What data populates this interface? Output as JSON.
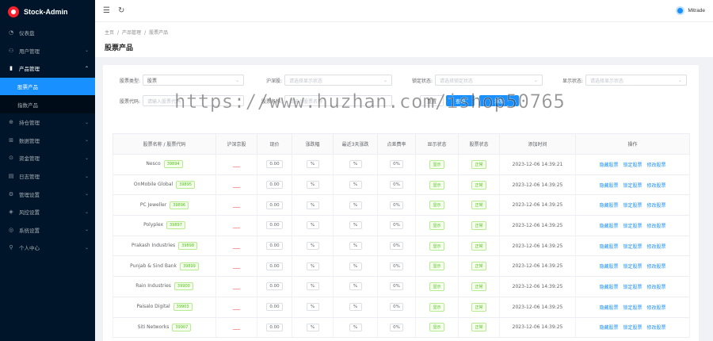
{
  "app": {
    "title": "Stock-Admin"
  },
  "sidebar": {
    "items": [
      {
        "label": "仪表盘",
        "icon": "dashboard-icon"
      },
      {
        "label": "用户管理",
        "icon": "users-icon"
      },
      {
        "label": "产品管理",
        "icon": "chart-icon",
        "open": true
      },
      {
        "label": "持仓管理",
        "icon": "position-icon"
      },
      {
        "label": "数据管理",
        "icon": "data-icon"
      },
      {
        "label": "资金管理",
        "icon": "funds-icon"
      },
      {
        "label": "日志管理",
        "icon": "log-icon"
      },
      {
        "label": "管理设置",
        "icon": "settings-icon"
      },
      {
        "label": "风控设置",
        "icon": "risk-icon"
      },
      {
        "label": "系统设置",
        "icon": "system-icon"
      },
      {
        "label": "个人中心",
        "icon": "user-icon"
      }
    ],
    "subitems": [
      {
        "label": "股票产品",
        "active": true
      },
      {
        "label": "指数产品"
      }
    ]
  },
  "header": {
    "user": "Mitrade"
  },
  "breadcrumb": [
    "主页",
    "产品管理",
    "股票产品"
  ],
  "page": {
    "title": "股票产品"
  },
  "filters": {
    "stock_type_label": "股票类型:",
    "stock_type_value": "股票",
    "exchange_label": "沪深股:",
    "exchange_placeholder": "请选择显示状态",
    "lock_label": "锁定状态:",
    "lock_placeholder": "请选择锁定状态",
    "display_label": "显示状态:",
    "display_placeholder": "请选择显示状态",
    "code_label": "股票代码:",
    "code_placeholder": "请输入股票代码",
    "name_label": "股票名称:",
    "name_placeholder": "请输入股票名称",
    "reset": "重置",
    "search": "查询",
    "add": "添加"
  },
  "table": {
    "headers": [
      "股票名称 / 股票代码",
      "沪深京股",
      "现价",
      "涨跌幅",
      "最近3天涨跌",
      "点差费率",
      "显示状态",
      "股票状态",
      "添加时间",
      "操作"
    ],
    "rows": [
      {
        "name": "Nesco",
        "code": "39894",
        "market": "___",
        "price": "0.00",
        "change": "%",
        "change3": "%",
        "spread": "0%",
        "display": "显示",
        "status": "正常",
        "time": "2023-12-06 14:39:21"
      },
      {
        "name": "OnMobile Global",
        "code": "39895",
        "market": "___",
        "price": "0.00",
        "change": "%",
        "change3": "%",
        "spread": "0%",
        "display": "显示",
        "status": "正常",
        "time": "2023-12-06 14:39:25"
      },
      {
        "name": "PC Jeweller",
        "code": "39896",
        "market": "___",
        "price": "0.00",
        "change": "%",
        "change3": "%",
        "spread": "0%",
        "display": "显示",
        "status": "正常",
        "time": "2023-12-06 14:39:25"
      },
      {
        "name": "Polyplex",
        "code": "39897",
        "market": "___",
        "price": "0.00",
        "change": "%",
        "change3": "%",
        "spread": "0%",
        "display": "显示",
        "status": "正常",
        "time": "2023-12-06 14:39:25"
      },
      {
        "name": "Prakash Industries",
        "code": "39898",
        "market": "___",
        "price": "0.00",
        "change": "%",
        "change3": "%",
        "spread": "0%",
        "display": "显示",
        "status": "正常",
        "time": "2023-12-06 14:39:25"
      },
      {
        "name": "Punjab & Sind Bank",
        "code": "39899",
        "market": "___",
        "price": "0.00",
        "change": "%",
        "change3": "%",
        "spread": "0%",
        "display": "显示",
        "status": "正常",
        "time": "2023-12-06 14:39:25"
      },
      {
        "name": "Rain Industries",
        "code": "39900",
        "market": "___",
        "price": "0.00",
        "change": "%",
        "change3": "%",
        "spread": "0%",
        "display": "显示",
        "status": "正常",
        "time": "2023-12-06 14:39:25"
      },
      {
        "name": "Paisalo Digital",
        "code": "39903",
        "market": "___",
        "price": "0.00",
        "change": "%",
        "change3": "%",
        "spread": "0%",
        "display": "显示",
        "status": "正常",
        "time": "2023-12-06 14:39:25"
      },
      {
        "name": "Siti Networks",
        "code": "39907",
        "market": "___",
        "price": "0.00",
        "change": "%",
        "change3": "%",
        "spread": "0%",
        "display": "显示",
        "status": "正常",
        "time": "2023-12-06 14:39:25"
      }
    ],
    "actions": [
      "隐藏股票",
      "锁定股票",
      "修改股票"
    ]
  },
  "watermark": "https://www.huzhan.com/ishop50765"
}
